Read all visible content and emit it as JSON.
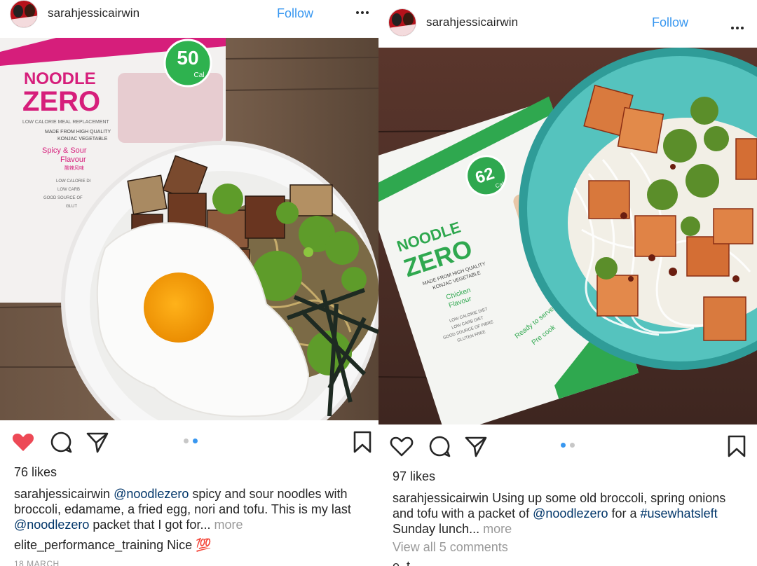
{
  "left_post": {
    "username": "sarahjessicairwin",
    "follow_label": "Follow",
    "likes": "76 likes",
    "caption": {
      "user": "sarahjessicairwin",
      "mention1": "@noodlezero",
      "text1": " spicy and sour noodles with broccoli, edamame, a fried egg, nori and tofu. This is my last ",
      "mention2": "@noodlezero",
      "text2": " packet that I got for...",
      "more": "more"
    },
    "comment": {
      "user": "elite_performance_training",
      "text": "Nice",
      "emoji": "💯"
    },
    "date": "18 MARCH",
    "liked": true,
    "carousel_active_index": 1,
    "carousel_count": 2,
    "packet": {
      "brand_line1": "NOODLE",
      "brand_line2": "ZERO",
      "calories": "50",
      "cal_unit": "Cal",
      "subtitle": "LOW CALORIE MEAL REPLACEMENT",
      "made_from": "MADE FROM HIGH QUALITY",
      "konjac": "KONJAC VEGETABLE",
      "flavour1": "Spicy & Sour",
      "flavour2": "Flavour",
      "chinese": "酸辣风味",
      "bullets": [
        "LOW CALORIE DI",
        "LOW CARB",
        "GOOD SOURCE OF",
        "GLUT"
      ]
    }
  },
  "right_post": {
    "username": "sarahjessicairwin",
    "follow_label": "Follow",
    "likes": "97 likes",
    "caption": {
      "user": "sarahjessicairwin",
      "text1": " Using up some old broccoli, spring onions and tofu with a packet of ",
      "mention1": "@noodlezero",
      "text2": " for a ",
      "hashtag": "#usewhatsleft",
      "text3": " Sunday lunch...",
      "more": "more"
    },
    "view_comments": "View all 5 comments",
    "partial_comment": "e_t...",
    "liked": false,
    "carousel_active_index": 0,
    "carousel_count": 2,
    "packet": {
      "brand_line1": "NOODLE",
      "brand_line2": "ZERO",
      "calories": "62",
      "cal_unit": "Cal",
      "made_from": "MADE FROM HIGH QUALITY",
      "konjac": "KONJAC VEGETABLE",
      "flavour1": "Chicken",
      "flavour2": "Flavour",
      "bullets": [
        "LOW CALORIE DIET",
        "LOW CARB DIET",
        "GOOD SOURCE OF FIBRE",
        "GLUTEN FREE"
      ],
      "serve1": "Ready to serve in",
      "serve2": "Pre cook"
    }
  },
  "colors": {
    "follow_blue": "#3897f0",
    "heart_red": "#ed4956",
    "mention_navy": "#003569",
    "muted_gray": "#999999",
    "dot_active": "#3897f0",
    "dot_inactive": "#c7c7c7"
  },
  "icons": [
    "heart-icon",
    "comment-icon",
    "share-icon",
    "bookmark-icon",
    "more-options-icon"
  ]
}
